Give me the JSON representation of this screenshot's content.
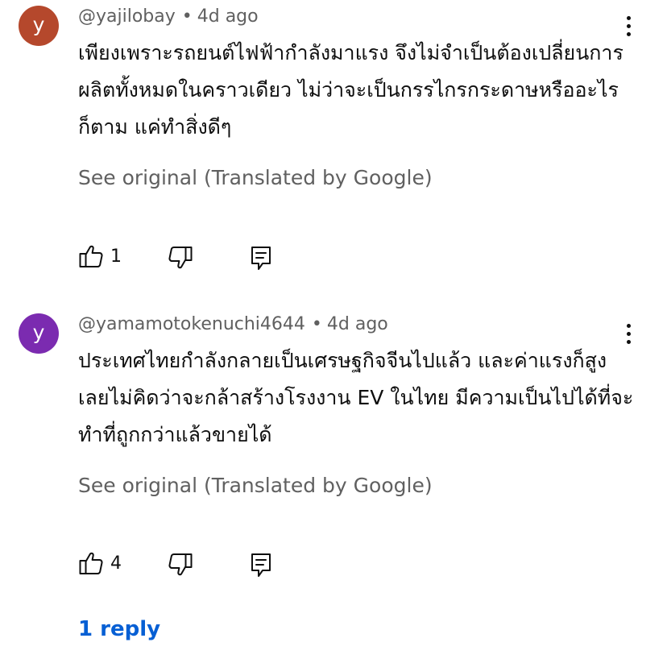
{
  "colors": {
    "avatar_1": "#b5482c",
    "avatar_2": "#7b2bb0",
    "link_blue": "#065fd4",
    "secondary_text": "#606060"
  },
  "comments": [
    {
      "avatar_letter": "y",
      "handle": "@yajilobay",
      "separator": "•",
      "time": "4d ago",
      "text": "เพียงเพราะรถยนต์ไฟฟ้ากำลังมาแรง จึงไม่จำเป็นต้องเปลี่ยนการผลิตทั้งหมดในคราวเดียว ไม่ว่าจะเป็นกรรไกรกระดาษหรืออะไรก็ตาม แค่ทำสิ่งดีๆ",
      "translate_label": "See original (Translated by Google)",
      "like_count": "1",
      "icons": [
        "thumbs-up-icon",
        "thumbs-down-icon",
        "reply-icon",
        "more-options-icon"
      ]
    },
    {
      "avatar_letter": "y",
      "handle": "@yamamotokenuchi4644",
      "separator": "•",
      "time": "4d ago",
      "text": "ประเทศไทยกำลังกลายเป็นเศรษฐกิจจีนไปแล้ว และค่าแรงก็สูง เลยไม่คิดว่าจะกล้าสร้างโรงงาน EV ในไทย มีความเป็นไปได้ที่จะทำที่ถูกกว่าแล้วขายได้",
      "translate_label": "See original (Translated by Google)",
      "like_count": "4",
      "icons": [
        "thumbs-up-icon",
        "thumbs-down-icon",
        "reply-icon",
        "more-options-icon"
      ]
    }
  ],
  "replies_label": "1 reply"
}
